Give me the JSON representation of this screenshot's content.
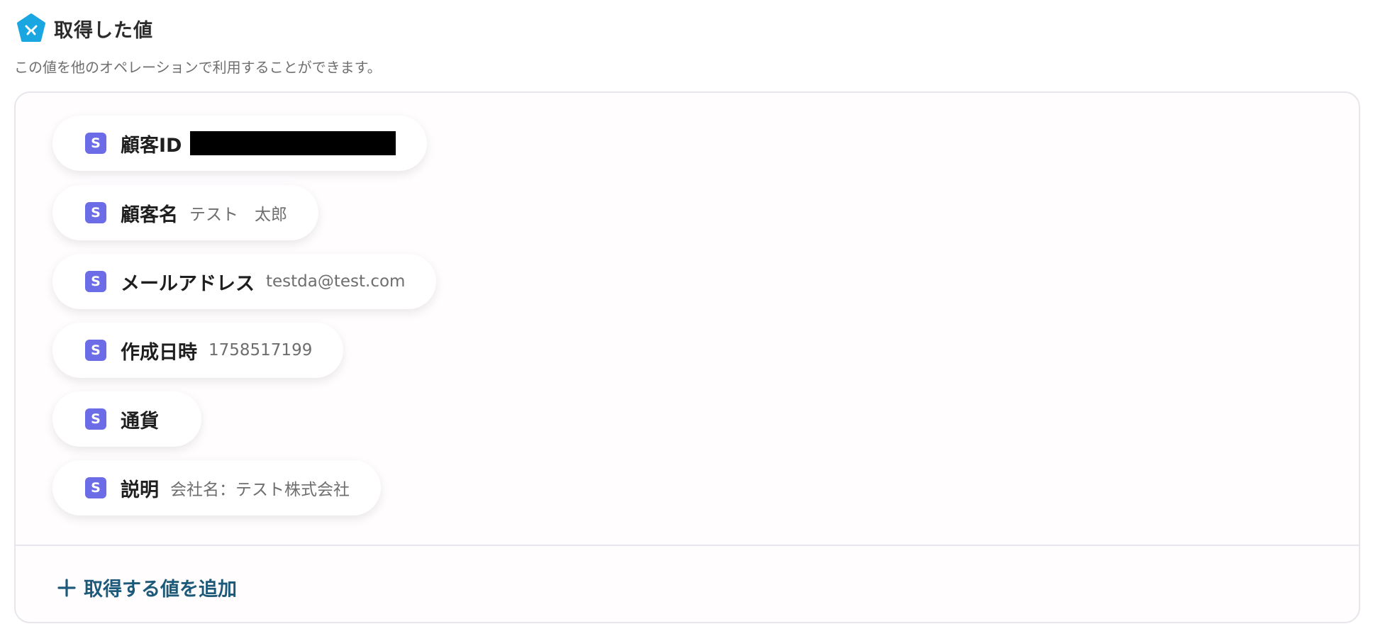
{
  "header": {
    "title": "取得した値",
    "icon": "yoom-pentagon-icon",
    "icon_color": "#1aa6e0"
  },
  "subtitle": "この値を他のオペレーションで利用することができます。",
  "fields": [
    {
      "badge": "S",
      "label": "顧客ID",
      "value": "",
      "redacted": true
    },
    {
      "badge": "S",
      "label": "顧客名",
      "value": "テスト　太郎"
    },
    {
      "badge": "S",
      "label": "メールアドレス",
      "value": "testda@test.com"
    },
    {
      "badge": "S",
      "label": "作成日時",
      "value": "1758517199"
    },
    {
      "badge": "S",
      "label": "通貨",
      "value": ""
    },
    {
      "badge": "S",
      "label": "説明",
      "value": "会社名：テスト株式会社"
    }
  ],
  "add_button": {
    "label": "取得する値を追加",
    "icon": "plus-icon"
  },
  "colors": {
    "badge": "#6b6ce6",
    "add_text": "#1d5a7a",
    "border": "#e6e6ec"
  }
}
